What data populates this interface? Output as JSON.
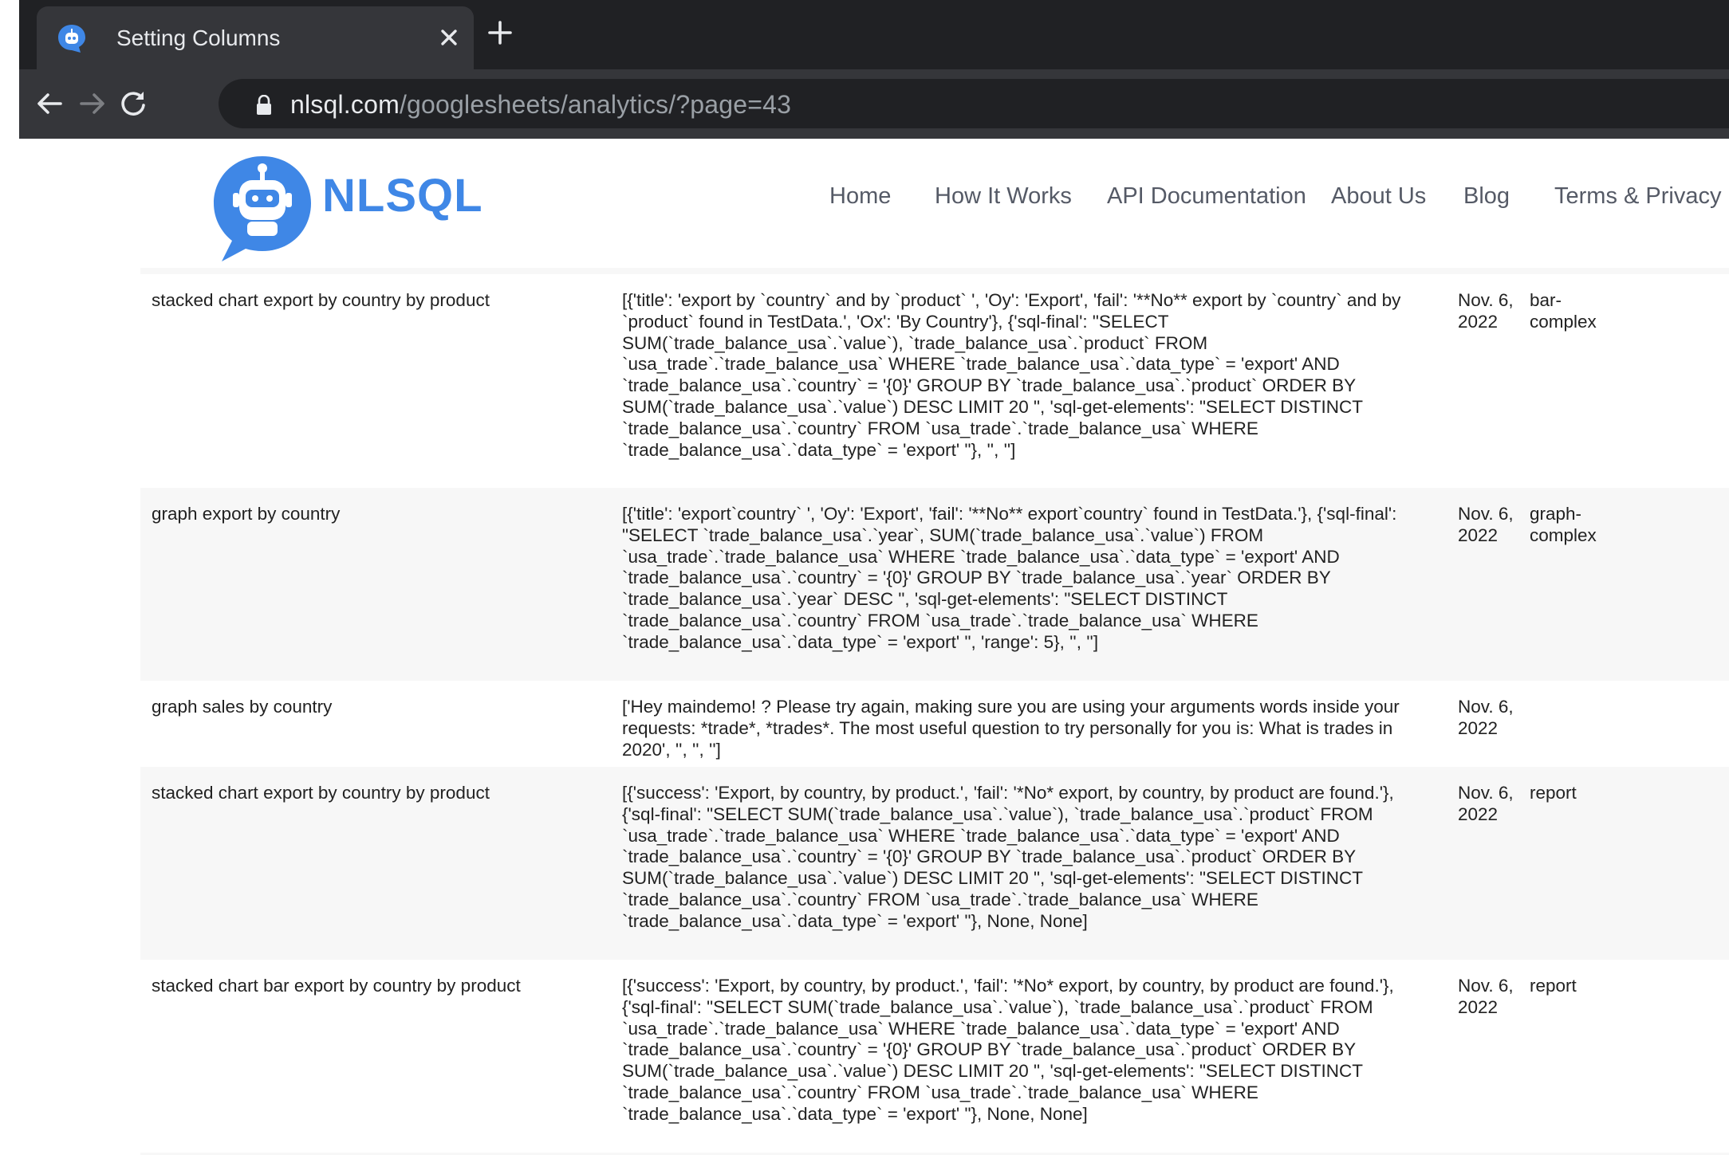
{
  "browser": {
    "tab_title": "Setting Columns",
    "url_host": "nlsql.com",
    "url_path": "/googlesheets/analytics/?page=43"
  },
  "site": {
    "logo_text": "NLSQL",
    "nav": [
      "Home",
      "How It Works",
      "API Documentation",
      "About Us",
      "Blog",
      "Terms & Privacy"
    ]
  },
  "rows": [
    {
      "question": "stacked chart export by country by product",
      "response": "[{'title': 'export by `country` and by `product` ', 'Oy': 'Export', 'fail': '**No** export by `country` and by `product` found in TestData.', 'Ox': 'By Country'}, {'sql-final': \"SELECT SUM(`trade_balance_usa`.`value`), `trade_balance_usa`.`product` FROM `usa_trade`.`trade_balance_usa` WHERE `trade_balance_usa`.`data_type` = 'export' AND `trade_balance_usa`.`country` = '{0}' GROUP BY `trade_balance_usa`.`product` ORDER BY SUM(`trade_balance_usa`.`value`) DESC LIMIT 20 \", 'sql-get-elements': \"SELECT DISTINCT `trade_balance_usa`.`country` FROM `usa_trade`.`trade_balance_usa` WHERE `trade_balance_usa`.`data_type` = 'export' \"}, '', '']",
      "date": "Nov. 6, 2022",
      "type": "bar-complex"
    },
    {
      "question": "graph export by country",
      "response": "[{'title': 'export`country` ', 'Oy': 'Export', 'fail': '**No** export`country` found in TestData.'}, {'sql-final': \"SELECT `trade_balance_usa`.`year`, SUM(`trade_balance_usa`.`value`) FROM `usa_trade`.`trade_balance_usa` WHERE `trade_balance_usa`.`data_type` = 'export' AND `trade_balance_usa`.`country` = '{0}' GROUP BY `trade_balance_usa`.`year` ORDER BY `trade_balance_usa`.`year` DESC \", 'sql-get-elements': \"SELECT DISTINCT `trade_balance_usa`.`country` FROM `usa_trade`.`trade_balance_usa` WHERE `trade_balance_usa`.`data_type` = 'export' \", 'range': 5}, '', '']",
      "date": "Nov. 6, 2022",
      "type": "graph-complex"
    },
    {
      "question": "graph sales by country",
      "response": "['Hey maindemo! ? Please try again, making sure you are using your arguments words inside your requests: *trade*, *trades*. The most useful question to try personally for you is: What is trades in 2020', '', '', '']",
      "date": "Nov. 6, 2022",
      "type": ""
    },
    {
      "question": "stacked chart export by country by product",
      "response": "[{'success': 'Export, by country, by product.', 'fail': '*No* export, by country, by product are found.'}, {'sql-final': \"SELECT SUM(`trade_balance_usa`.`value`), `trade_balance_usa`.`product` FROM `usa_trade`.`trade_balance_usa` WHERE `trade_balance_usa`.`data_type` = 'export' AND `trade_balance_usa`.`country` = '{0}' GROUP BY `trade_balance_usa`.`product` ORDER BY SUM(`trade_balance_usa`.`value`) DESC LIMIT 20 \", 'sql-get-elements': \"SELECT DISTINCT `trade_balance_usa`.`country` FROM `usa_trade`.`trade_balance_usa` WHERE `trade_balance_usa`.`data_type` = 'export' \"}, None, None]",
      "date": "Nov. 6, 2022",
      "type": "report"
    },
    {
      "question": "stacked chart bar export by country by product",
      "response": "[{'success': 'Export, by country, by product.', 'fail': '*No* export, by country, by product are found.'}, {'sql-final': \"SELECT SUM(`trade_balance_usa`.`value`), `trade_balance_usa`.`product` FROM `usa_trade`.`trade_balance_usa` WHERE `trade_balance_usa`.`data_type` = 'export' AND `trade_balance_usa`.`country` = '{0}' GROUP BY `trade_balance_usa`.`product` ORDER BY SUM(`trade_balance_usa`.`value`) DESC LIMIT 20 \", 'sql-get-elements': \"SELECT DISTINCT `trade_balance_usa`.`country` FROM `usa_trade`.`trade_balance_usa` WHERE `trade_balance_usa`.`data_type` = 'export' \"}, None, None]",
      "date": "Nov. 6, 2022",
      "type": "report"
    }
  ]
}
